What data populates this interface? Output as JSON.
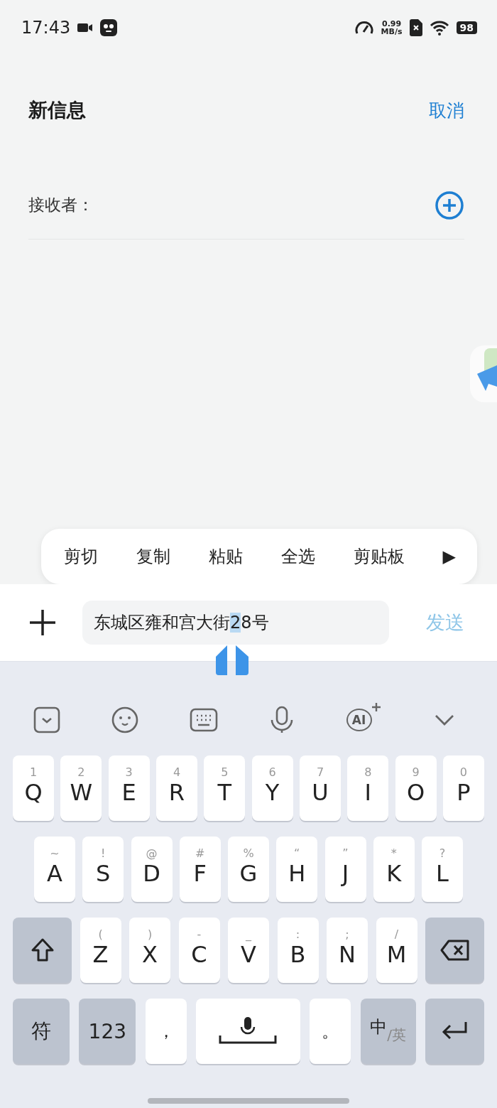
{
  "status_bar": {
    "time": "17:43",
    "net_speed": "0.99",
    "net_unit": "MB/s",
    "battery": "98"
  },
  "header": {
    "title": "新信息",
    "cancel": "取消"
  },
  "recipient": {
    "label": "接收者："
  },
  "context_menu": {
    "items": [
      "剪切",
      "复制",
      "粘贴",
      "全选",
      "剪贴板"
    ],
    "more": "▶"
  },
  "composer": {
    "text_before": "东城区雍和宫大街",
    "text_selected": "2",
    "text_after": "8号",
    "send": "发送",
    "send_disabled": true
  },
  "keyboard": {
    "toolbar": [
      {
        "kind": "collapse"
      },
      {
        "kind": "emoji"
      },
      {
        "kind": "layout"
      },
      {
        "kind": "voice"
      },
      {
        "kind": "ai",
        "label": "AI"
      },
      {
        "kind": "hide"
      }
    ],
    "rows": [
      {
        "keys": [
          {
            "kind": "letter",
            "label": "Q",
            "hint": "1"
          },
          {
            "kind": "letter",
            "label": "W",
            "hint": "2"
          },
          {
            "kind": "letter",
            "label": "E",
            "hint": "3"
          },
          {
            "kind": "letter",
            "label": "R",
            "hint": "4"
          },
          {
            "kind": "letter",
            "label": "T",
            "hint": "5"
          },
          {
            "kind": "letter",
            "label": "Y",
            "hint": "6"
          },
          {
            "kind": "letter",
            "label": "U",
            "hint": "7"
          },
          {
            "kind": "letter",
            "label": "I",
            "hint": "8"
          },
          {
            "kind": "letter",
            "label": "O",
            "hint": "9"
          },
          {
            "kind": "letter",
            "label": "P",
            "hint": "0"
          }
        ]
      },
      {
        "keys": [
          {
            "kind": "letter",
            "label": "A",
            "hint": "~"
          },
          {
            "kind": "letter",
            "label": "S",
            "hint": "!"
          },
          {
            "kind": "letter",
            "label": "D",
            "hint": "@"
          },
          {
            "kind": "letter",
            "label": "F",
            "hint": "#"
          },
          {
            "kind": "letter",
            "label": "G",
            "hint": "%"
          },
          {
            "kind": "letter",
            "label": "H",
            "hint": "“"
          },
          {
            "kind": "letter",
            "label": "J",
            "hint": "”"
          },
          {
            "kind": "letter",
            "label": "K",
            "hint": "*"
          },
          {
            "kind": "letter",
            "label": "L",
            "hint": "?"
          }
        ]
      },
      {
        "keys": [
          {
            "kind": "shift"
          },
          {
            "kind": "letter",
            "label": "Z",
            "hint": "("
          },
          {
            "kind": "letter",
            "label": "X",
            "hint": ")"
          },
          {
            "kind": "letter",
            "label": "C",
            "hint": "-"
          },
          {
            "kind": "letter",
            "label": "V",
            "hint": "_"
          },
          {
            "kind": "letter",
            "label": "B",
            "hint": ":"
          },
          {
            "kind": "letter",
            "label": "N",
            "hint": ";"
          },
          {
            "kind": "letter",
            "label": "M",
            "hint": "/"
          },
          {
            "kind": "delete"
          }
        ]
      },
      {
        "keys": [
          {
            "kind": "symbol",
            "label": "符"
          },
          {
            "kind": "symbol",
            "label": "123"
          },
          {
            "kind": "punct",
            "label": "，"
          },
          {
            "kind": "space"
          },
          {
            "kind": "punct",
            "label": "。"
          },
          {
            "kind": "lang",
            "label": "中",
            "sub": "/英"
          },
          {
            "kind": "enter"
          }
        ]
      }
    ]
  }
}
